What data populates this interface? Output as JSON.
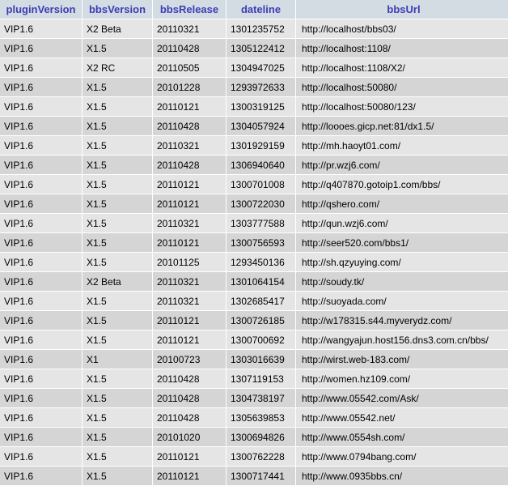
{
  "columns": [
    "pluginVersion",
    "bbsVersion",
    "bbsRelease",
    "dateline",
    "bbsUrl"
  ],
  "rows": [
    [
      "VIP1.6",
      "X2 Beta",
      "20110321",
      "1301235752",
      "http://localhost/bbs03/"
    ],
    [
      "VIP1.6",
      "X1.5",
      "20110428",
      "1305122412",
      "http://localhost:1108/"
    ],
    [
      "VIP1.6",
      "X2 RC",
      "20110505",
      "1304947025",
      "http://localhost:1108/X2/"
    ],
    [
      "VIP1.6",
      "X1.5",
      "20101228",
      "1293972633",
      "http://localhost:50080/"
    ],
    [
      "VIP1.6",
      "X1.5",
      "20110121",
      "1300319125",
      "http://localhost:50080/123/"
    ],
    [
      "VIP1.6",
      "X1.5",
      "20110428",
      "1304057924",
      "http://loooes.gicp.net:81/dx1.5/"
    ],
    [
      "VIP1.6",
      "X1.5",
      "20110321",
      "1301929159",
      "http://mh.haoyt01.com/"
    ],
    [
      "VIP1.6",
      "X1.5",
      "20110428",
      "1306940640",
      "http://pr.wzj6.com/"
    ],
    [
      "VIP1.6",
      "X1.5",
      "20110121",
      "1300701008",
      "http://q407870.gotoip1.com/bbs/"
    ],
    [
      "VIP1.6",
      "X1.5",
      "20110121",
      "1300722030",
      "http://qshero.com/"
    ],
    [
      "VIP1.6",
      "X1.5",
      "20110321",
      "1303777588",
      "http://qun.wzj6.com/"
    ],
    [
      "VIP1.6",
      "X1.5",
      "20110121",
      "1300756593",
      "http://seer520.com/bbs1/"
    ],
    [
      "VIP1.6",
      "X1.5",
      "20101125",
      "1293450136",
      "http://sh.qzyuying.com/"
    ],
    [
      "VIP1.6",
      "X2 Beta",
      "20110321",
      "1301064154",
      "http://soudy.tk/"
    ],
    [
      "VIP1.6",
      "X1.5",
      "20110321",
      "1302685417",
      "http://suoyada.com/"
    ],
    [
      "VIP1.6",
      "X1.5",
      "20110121",
      "1300726185",
      "http://w178315.s44.myverydz.com/"
    ],
    [
      "VIP1.6",
      "X1.5",
      "20110121",
      "1300700692",
      "http://wangyajun.host156.dns3.com.cn/bbs/"
    ],
    [
      "VIP1.6",
      "X1",
      "20100723",
      "1303016639",
      "http://wirst.web-183.com/"
    ],
    [
      "VIP1.6",
      "X1.5",
      "20110428",
      "1307119153",
      "http://women.hz109.com/"
    ],
    [
      "VIP1.6",
      "X1.5",
      "20110428",
      "1304738197",
      "http://www.05542.com/Ask/"
    ],
    [
      "VIP1.6",
      "X1.5",
      "20110428",
      "1305639853",
      "http://www.05542.net/"
    ],
    [
      "VIP1.6",
      "X1.5",
      "20101020",
      "1300694826",
      "http://www.0554sh.com/"
    ],
    [
      "VIP1.6",
      "X1.5",
      "20110121",
      "1300762228",
      "http://www.0794bang.com/"
    ],
    [
      "VIP1.6",
      "X1.5",
      "20110121",
      "1300717441",
      "http://www.0935bbs.cn/"
    ]
  ]
}
